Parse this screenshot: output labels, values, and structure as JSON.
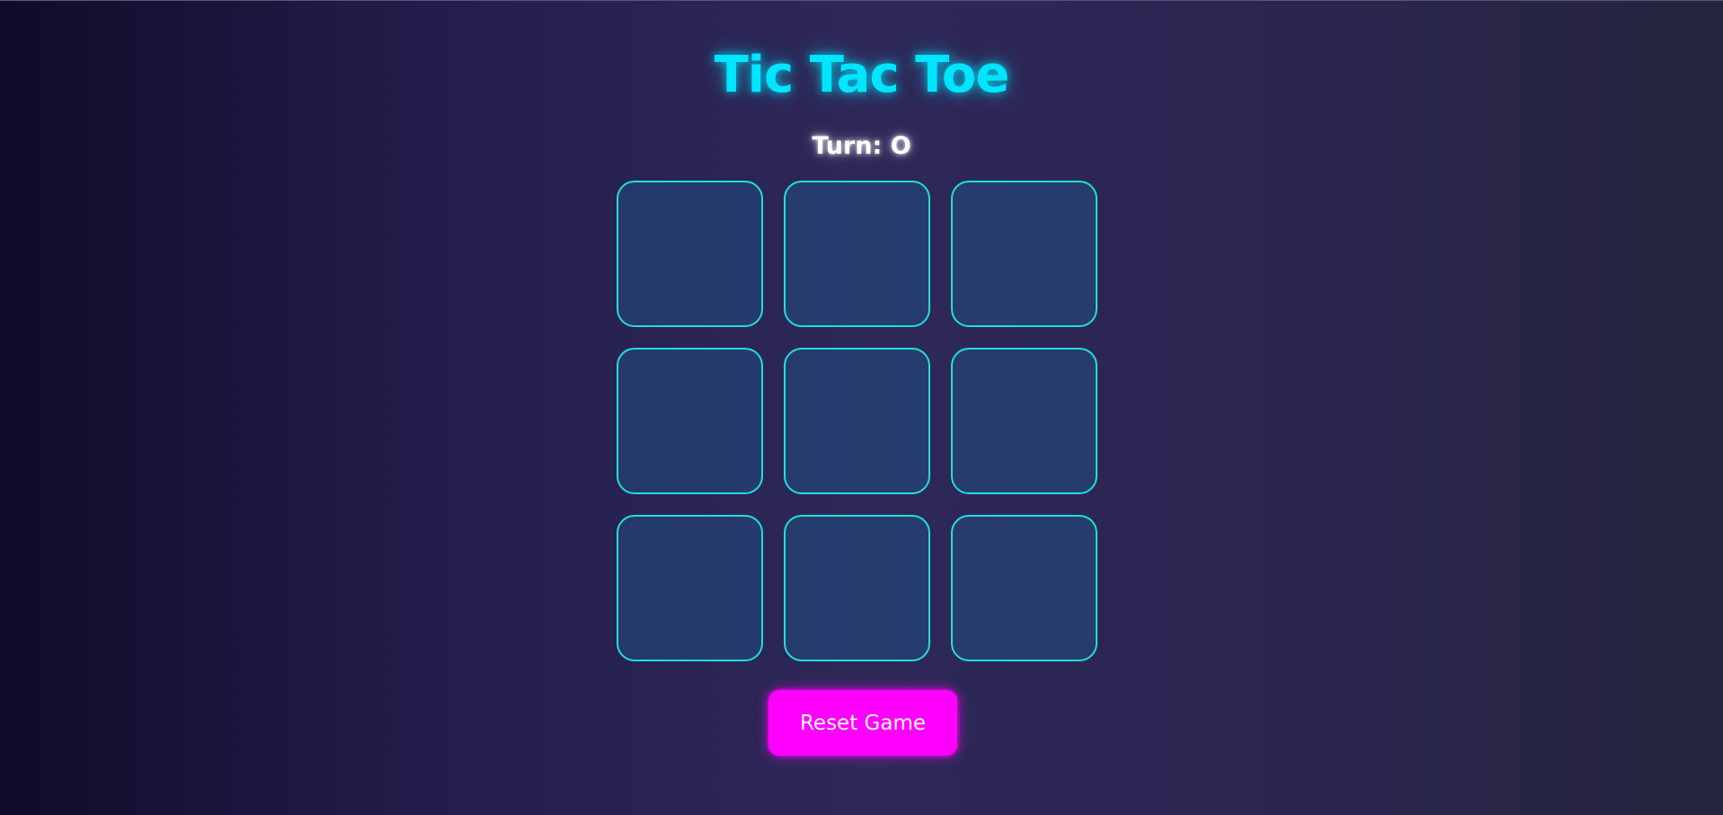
{
  "game": {
    "title": "Tic Tac Toe",
    "status": "Turn: O",
    "board": [
      "",
      "",
      "",
      "",
      "",
      "",
      "",
      "",
      ""
    ],
    "reset_label": "Reset Game"
  },
  "colors": {
    "title": "#00e5ff",
    "cell_border": "#1fe0d6",
    "reset_button": "#ff00ff"
  }
}
